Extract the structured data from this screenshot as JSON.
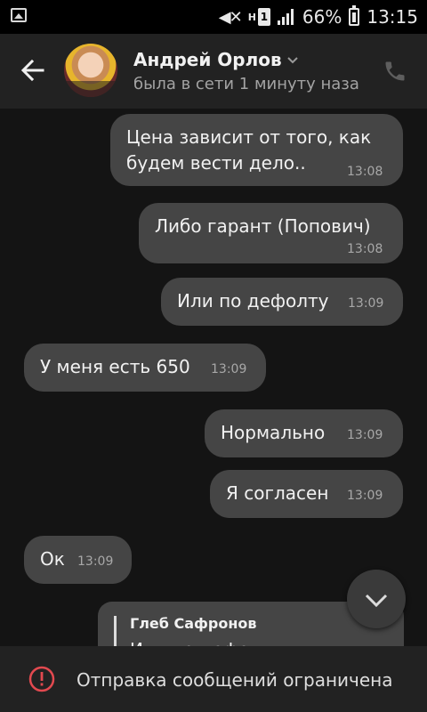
{
  "status_bar": {
    "network_h": "H",
    "sim": "1",
    "battery": "66%",
    "time": "13:15"
  },
  "header": {
    "contact_name": "Андрей Орлов",
    "last_seen": "была в сети 1 минуту наза",
    "icons": [
      "back-arrow-icon",
      "chevron-down-icon",
      "phone-icon"
    ]
  },
  "messages": [
    {
      "text": "Цена зависит от того, как\nбудем вести дело..",
      "time": "13:08",
      "direction": "outgoing"
    },
    {
      "text": "Либо гарант (Попович)",
      "time": "13:08",
      "direction": "outgoing"
    },
    {
      "text": "Или по дефолту",
      "time": "13:09",
      "direction": "outgoing"
    },
    {
      "text": "У меня есть 650",
      "time": "13:09",
      "direction": "incoming"
    },
    {
      "text": "Нормально",
      "time": "13:09",
      "direction": "outgoing"
    },
    {
      "text": "Я согласен",
      "time": "13:09",
      "direction": "outgoing"
    },
    {
      "text": "Ок",
      "time": "13:09",
      "direction": "incoming"
    }
  ],
  "reply_preview": {
    "author": "Глеб Сафронов",
    "quote": "Или по дефолту"
  },
  "footer": {
    "restriction_text": "Отправка сообщений ограничена"
  },
  "colors": {
    "chat_background": "#141414",
    "bubble": "#454545",
    "header": "#222222",
    "warning": "#e2494f"
  }
}
